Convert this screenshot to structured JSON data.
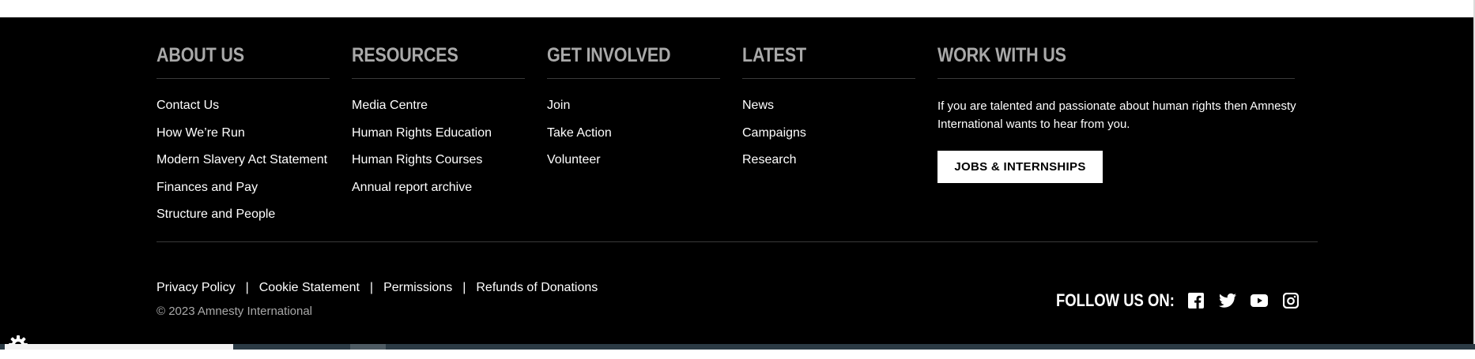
{
  "footer": {
    "columns": [
      {
        "heading": "ABOUT US",
        "links": [
          "Contact Us",
          "How We’re Run",
          "Modern Slavery Act Statement",
          "Finances and Pay",
          "Structure and People"
        ]
      },
      {
        "heading": "RESOURCES",
        "links": [
          "Media Centre",
          "Human Rights Education",
          "Human Rights Courses",
          "Annual report archive"
        ]
      },
      {
        "heading": "GET INVOLVED",
        "links": [
          "Join",
          "Take Action",
          "Volunteer"
        ]
      },
      {
        "heading": "LATEST",
        "links": [
          "News",
          "Campaigns",
          "Research"
        ]
      }
    ],
    "work_with_us": {
      "heading": "WORK WITH US",
      "text": "If you are talented and passionate about human rights then Amnesty International wants to hear from you.",
      "button_label": "JOBS & INTERNSHIPS"
    },
    "legal_links": [
      "Privacy Policy",
      "Cookie Statement",
      "Permissions",
      "Refunds of Donations"
    ],
    "separator": "|",
    "copyright": "© 2023 Amnesty International",
    "follow_label": "FOLLOW US ON:",
    "social": [
      {
        "name": "facebook-icon"
      },
      {
        "name": "twitter-icon"
      },
      {
        "name": "youtube-icon"
      },
      {
        "name": "instagram-icon"
      }
    ]
  },
  "colors": {
    "background": "#000000",
    "heading": "#a9a9a9",
    "text": "#ffffff",
    "rule": "#3a3a3a",
    "button_bg": "#ffffff",
    "button_text": "#000000"
  },
  "icons": {
    "cookie_settings": "gear-icon"
  }
}
